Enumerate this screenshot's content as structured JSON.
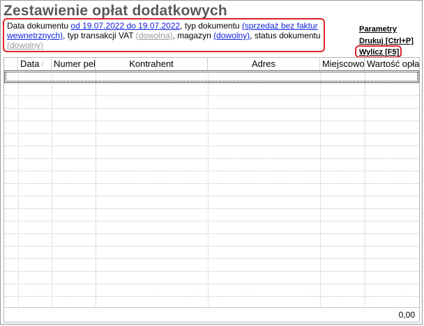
{
  "title": "Zestawienie opłat dodatkowych",
  "filter": {
    "t1": "Data dokumentu ",
    "date_range": "od 19.07.2022 do 19.07.2022",
    "t2": ", typ dokumentu ",
    "doc_type": "(sprzedaż bez faktur wewnetrznych)",
    "t3": ", typ transakcji VAT ",
    "vat_type": "(dowolna)",
    "t4": ", magazyn ",
    "warehouse": "(dowolny)",
    "t5": ", status dokumentu ",
    "status": "(dowolny)"
  },
  "actions": {
    "parametry": "Parametry",
    "drukuj": "Drukuj [Ctrl+P]",
    "wylicz": "Wylicz [F5]"
  },
  "table": {
    "columns": [
      "Data",
      "Numer peł",
      "Kontrahent",
      "Adres",
      "Miejscowo",
      "Wartość opła"
    ],
    "rows": []
  },
  "footer": {
    "total": "0,00"
  },
  "colors": {
    "highlight": "#e0242c",
    "link": "#0a1ee0",
    "link_muted": "#9a9a9a",
    "title": "#5a5a5a"
  }
}
